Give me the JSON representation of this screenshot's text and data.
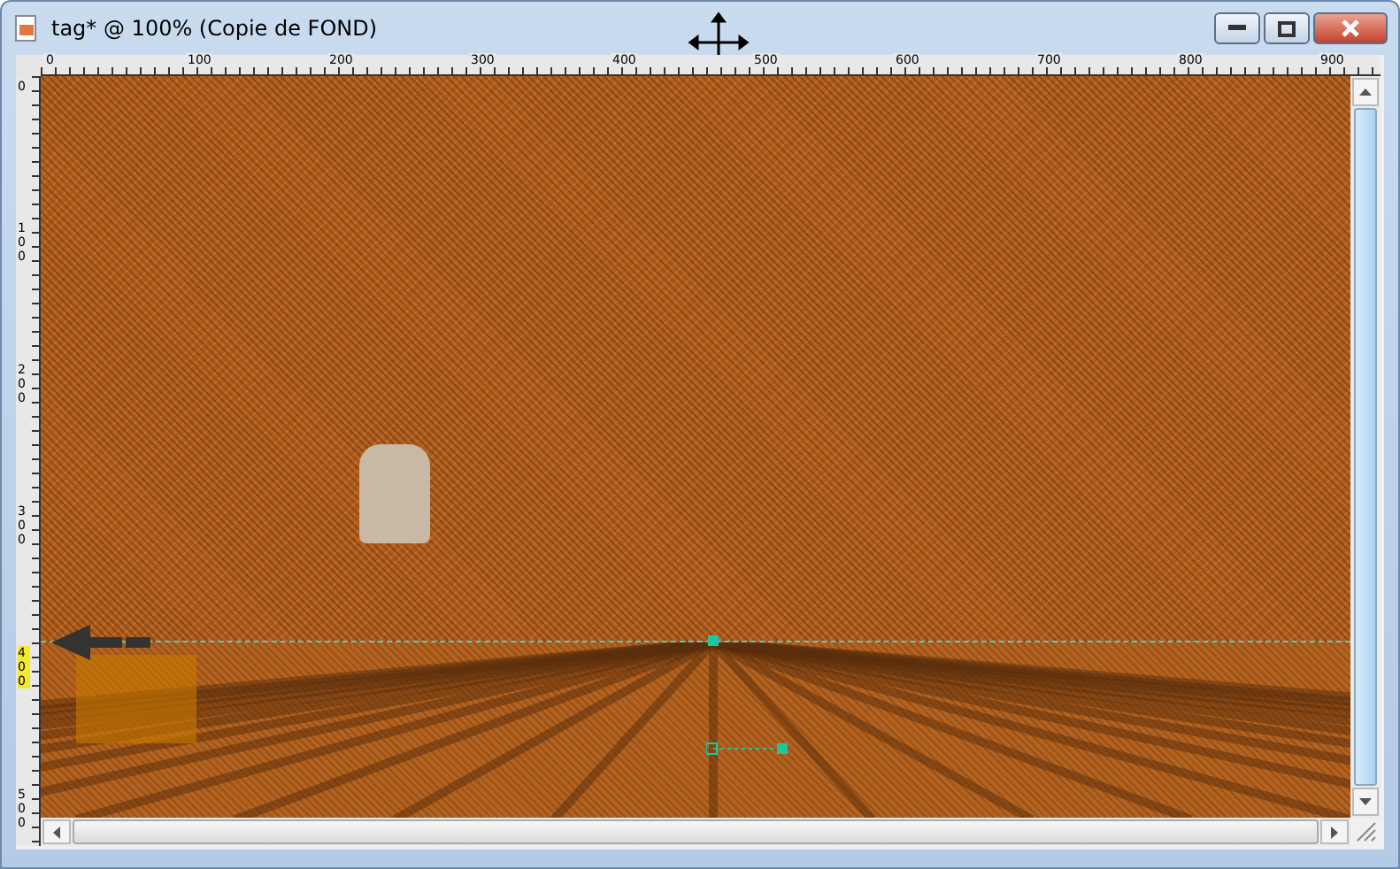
{
  "window": {
    "title": "tag* @ 100% (Copie de FOND)"
  },
  "ruler_top": {
    "labels": [
      "0",
      "100",
      "200",
      "300",
      "400",
      "500",
      "600",
      "700",
      "800",
      "900"
    ]
  },
  "ruler_left": {
    "labels": [
      "0",
      "100",
      "200",
      "300",
      "400",
      "500"
    ]
  }
}
